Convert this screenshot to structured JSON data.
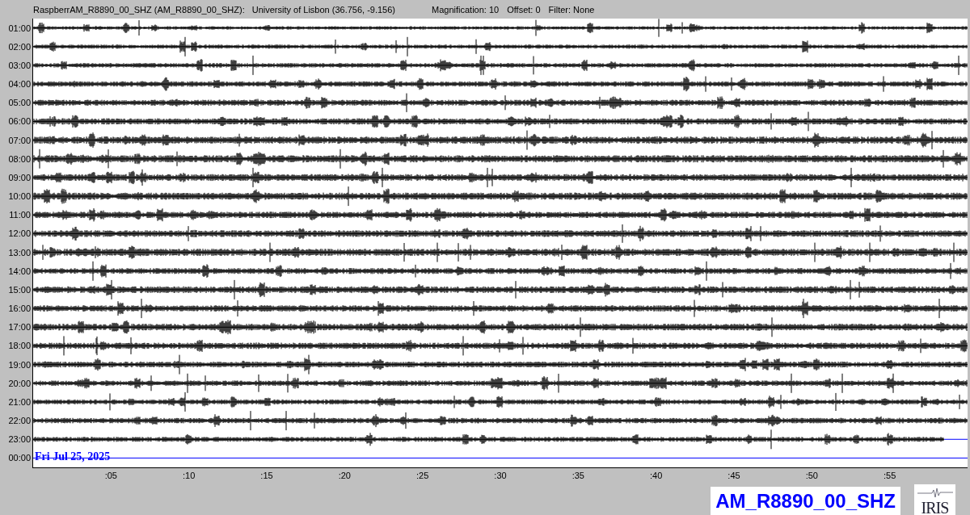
{
  "header": {
    "station": "RaspberrAM_R8890_00_SHZ (AM_R8890_00_SHZ):",
    "location": "University of Lisbon (36.756, -9.156)",
    "magnification": "Magnification: 10",
    "offset": "Offset: 0",
    "filter": "Filter: None"
  },
  "helicorder": {
    "date": "Fri Jul 25, 2025",
    "rows": [
      {
        "hour": "01:00",
        "kind": "trace"
      },
      {
        "hour": "02:00",
        "kind": "trace"
      },
      {
        "hour": "03:00",
        "kind": "trace"
      },
      {
        "hour": "04:00",
        "kind": "trace"
      },
      {
        "hour": "05:00",
        "kind": "trace"
      },
      {
        "hour": "06:00",
        "kind": "trace"
      },
      {
        "hour": "07:00",
        "kind": "trace"
      },
      {
        "hour": "08:00",
        "kind": "trace"
      },
      {
        "hour": "09:00",
        "kind": "trace"
      },
      {
        "hour": "10:00",
        "kind": "trace"
      },
      {
        "hour": "11:00",
        "kind": "trace"
      },
      {
        "hour": "12:00",
        "kind": "trace"
      },
      {
        "hour": "13:00",
        "kind": "trace"
      },
      {
        "hour": "14:00",
        "kind": "trace"
      },
      {
        "hour": "15:00",
        "kind": "trace"
      },
      {
        "hour": "16:00",
        "kind": "trace"
      },
      {
        "hour": "17:00",
        "kind": "trace"
      },
      {
        "hour": "18:00",
        "kind": "trace"
      },
      {
        "hour": "19:00",
        "kind": "trace"
      },
      {
        "hour": "20:00",
        "kind": "trace"
      },
      {
        "hour": "21:00",
        "kind": "trace"
      },
      {
        "hour": "22:00",
        "kind": "trace"
      },
      {
        "hour": "23:00",
        "kind": "partial",
        "level": 0.975
      },
      {
        "hour": "00:00",
        "kind": "empty"
      }
    ],
    "minute_ticks": [
      ":05",
      ":10",
      ":15",
      ":20",
      ":25",
      ":30",
      ":35",
      ":40",
      ":45",
      ":50",
      ":55"
    ]
  },
  "station_label": "AM_R8890_00_SHZ",
  "logo": "IRIS"
}
